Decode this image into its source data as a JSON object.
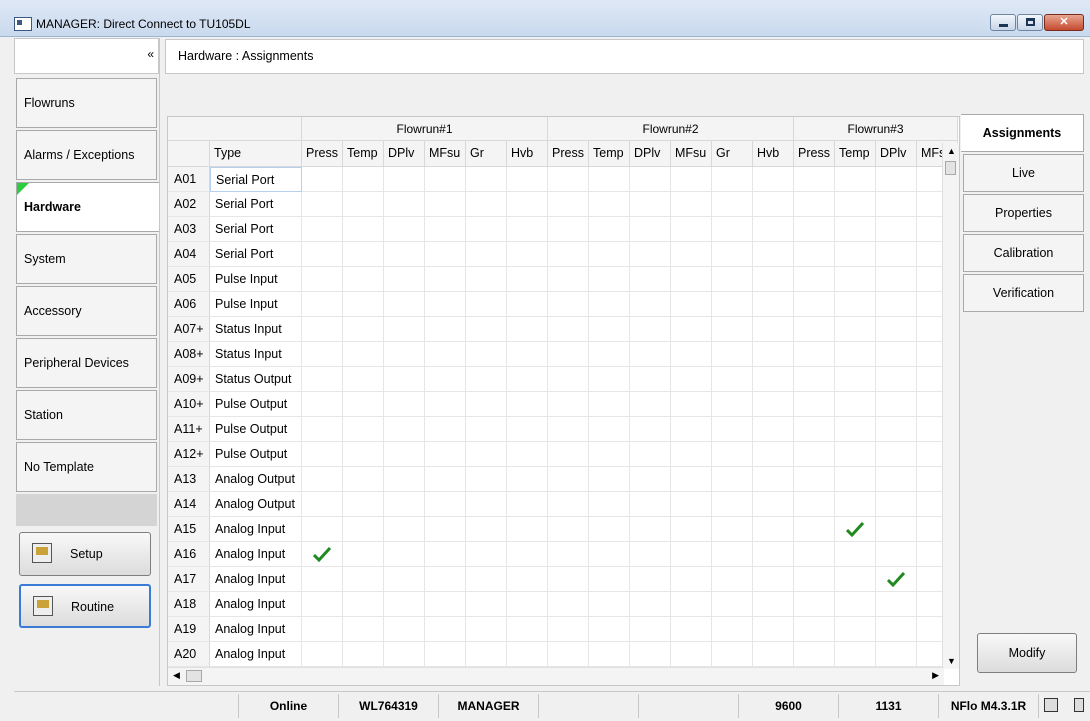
{
  "window": {
    "title": "MANAGER: Direct Connect to TU105DL"
  },
  "sidebar": {
    "collapse_glyph": "«",
    "items": [
      {
        "label": "Flowruns"
      },
      {
        "label": "Alarms / Exceptions"
      },
      {
        "label": "Hardware",
        "active": true
      },
      {
        "label": "System"
      },
      {
        "label": "Accessory"
      },
      {
        "label": "Peripheral Devices"
      },
      {
        "label": "Station"
      },
      {
        "label": "No Template"
      }
    ],
    "setup_label": "Setup",
    "routine_label": "Routine"
  },
  "breadcrumb": "Hardware : Assignments",
  "grid": {
    "groups": [
      "Flowrun#1",
      "Flowrun#2",
      "Flowrun#3"
    ],
    "type_header": "Type",
    "columns": [
      "Press",
      "Temp",
      "DPlv",
      "MFsu",
      "Gr",
      "Hvb",
      "Press",
      "Temp",
      "DPlv",
      "MFsu",
      "Gr",
      "Hvb",
      "Press",
      "Temp",
      "DPlv",
      "MFs"
    ],
    "rows": [
      {
        "id": "A01",
        "type": "Serial Port"
      },
      {
        "id": "A02",
        "type": "Serial Port"
      },
      {
        "id": "A03",
        "type": "Serial Port"
      },
      {
        "id": "A04",
        "type": "Serial Port"
      },
      {
        "id": "A05",
        "type": "Pulse Input"
      },
      {
        "id": "A06",
        "type": "Pulse Input"
      },
      {
        "id": "A07+",
        "type": "Status Input"
      },
      {
        "id": "A08+",
        "type": "Status Input"
      },
      {
        "id": "A09+",
        "type": "Status Output"
      },
      {
        "id": "A10+",
        "type": "Pulse Output"
      },
      {
        "id": "A11+",
        "type": "Pulse Output"
      },
      {
        "id": "A12+",
        "type": "Pulse Output"
      },
      {
        "id": "A13",
        "type": "Analog Output"
      },
      {
        "id": "A14",
        "type": "Analog Output"
      },
      {
        "id": "A15",
        "type": "Analog Input"
      },
      {
        "id": "A16",
        "type": "Analog Input"
      },
      {
        "id": "A17",
        "type": "Analog Input"
      },
      {
        "id": "A18",
        "type": "Analog Input"
      },
      {
        "id": "A19",
        "type": "Analog Input"
      },
      {
        "id": "A20",
        "type": "Analog Input"
      }
    ],
    "checks": [
      {
        "row": "A15",
        "group": "Flowrun#3",
        "column": "Temp"
      },
      {
        "row": "A16",
        "group": "Flowrun#1",
        "column": "Press"
      },
      {
        "row": "A17",
        "group": "Flowrun#3",
        "column": "DPlv"
      }
    ],
    "check_color": "#1f8a1f"
  },
  "tabs": [
    {
      "label": "Assignments",
      "active": true
    },
    {
      "label": "Live"
    },
    {
      "label": "Properties"
    },
    {
      "label": "Calibration"
    },
    {
      "label": "Verification"
    }
  ],
  "modify_label": "Modify",
  "status": {
    "connection": "Online",
    "device_id": "WL764319",
    "user": "MANAGER",
    "baud": "9600",
    "address": "1131",
    "version": "NFlo M4.3.1R"
  }
}
